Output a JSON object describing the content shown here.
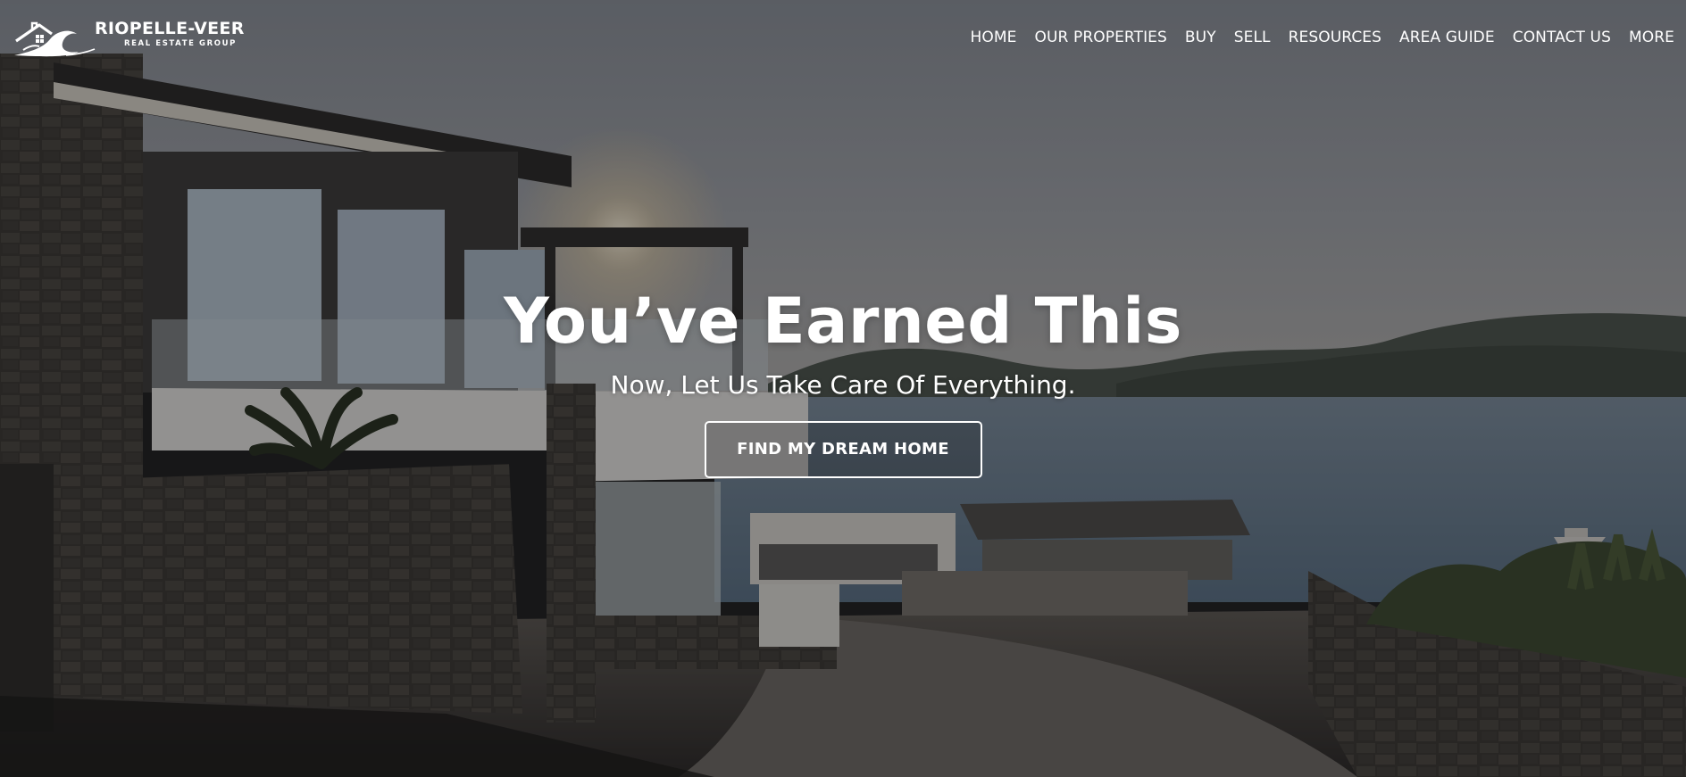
{
  "brand": {
    "name": "RIOPELLE-VEER",
    "subtitle": "REAL ESTATE GROUP",
    "logo_icon": "house-wave-logo-icon"
  },
  "nav": {
    "items": [
      {
        "label": "HOME"
      },
      {
        "label": "OUR PROPERTIES"
      },
      {
        "label": "BUY"
      },
      {
        "label": "SELL"
      },
      {
        "label": "RESOURCES"
      },
      {
        "label": "AREA GUIDE"
      },
      {
        "label": "CONTACT US"
      },
      {
        "label": "MORE"
      }
    ]
  },
  "hero": {
    "title": "You’ve Earned This",
    "subtitle": "Now, Let Us Take Care Of Everything.",
    "cta_label": "FIND MY DREAM HOME",
    "background": "coastal-modern-villa-photo"
  },
  "colors": {
    "text": "#ffffff",
    "sky": "#8e949d",
    "sea": "#5f7588",
    "stone": "#3b3935",
    "overlay": "#000000"
  }
}
